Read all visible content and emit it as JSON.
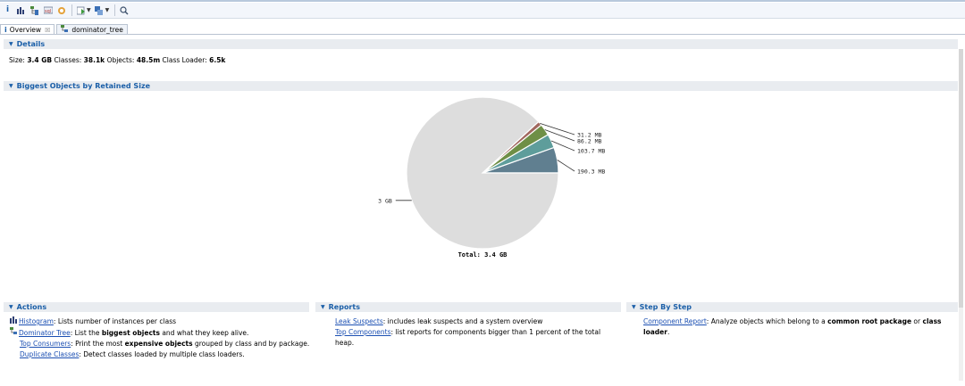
{
  "tabs": [
    {
      "label": "Overview",
      "icon": "info-icon",
      "close": "☒"
    },
    {
      "label": "dominator_tree",
      "icon": "tree-icon"
    }
  ],
  "details": {
    "section_title": "Details",
    "size_label": "Size:",
    "size_value": "3.4 GB",
    "classes_label": "Classes:",
    "classes_value": "38.1k",
    "objects_label": "Objects:",
    "objects_value": "48.5m",
    "loader_label": "Class Loader:",
    "loader_value": "6.5k"
  },
  "biggest": {
    "section_title": "Biggest Objects by Retained Size",
    "total_label": "Total: 3.4 GB"
  },
  "chart_data": {
    "type": "pie",
    "total": "Total: 3.4 GB",
    "slices": [
      {
        "label": "190.3 MB",
        "value": 190.3,
        "color": "#607f90"
      },
      {
        "label": "103.7 MB",
        "value": 103.7,
        "color": "#5e9d9b"
      },
      {
        "label": "86.2 MB",
        "value": 86.2,
        "color": "#6f8f46"
      },
      {
        "label": "31.2 MB",
        "value": 31.2,
        "color": "#a1675e"
      },
      {
        "label": "3 GB",
        "value": 3072,
        "color": "#dddddd"
      }
    ]
  },
  "actions": {
    "section_title": "Actions",
    "items": [
      {
        "link": "Histogram",
        "text": ": Lists number of instances per class",
        "bold": "",
        "after": ""
      },
      {
        "link": "Dominator Tree",
        "text": ": List the ",
        "bold": "biggest objects",
        "after": " and what they keep alive."
      },
      {
        "link": "Top Consumers",
        "text": ": Print the most ",
        "bold": "expensive objects",
        "after": " grouped by class and by package."
      },
      {
        "link": "Duplicate Classes",
        "text": ": Detect classes loaded by multiple class loaders.",
        "bold": "",
        "after": ""
      }
    ]
  },
  "reports": {
    "section_title": "Reports",
    "items": [
      {
        "link": "Leak Suspects",
        "text": ": includes leak suspects and a system overview"
      },
      {
        "link": "Top Components",
        "text": ": list reports for components bigger than 1 percent of the total",
        "text2": "heap."
      }
    ]
  },
  "stepbystep": {
    "section_title": "Step By Step",
    "link": "Component Report",
    "text": ": Analyze objects which belong to a ",
    "bold1": "common root package",
    "mid": " or ",
    "bold2": "class",
    "bold3": "loader",
    "end": "."
  }
}
